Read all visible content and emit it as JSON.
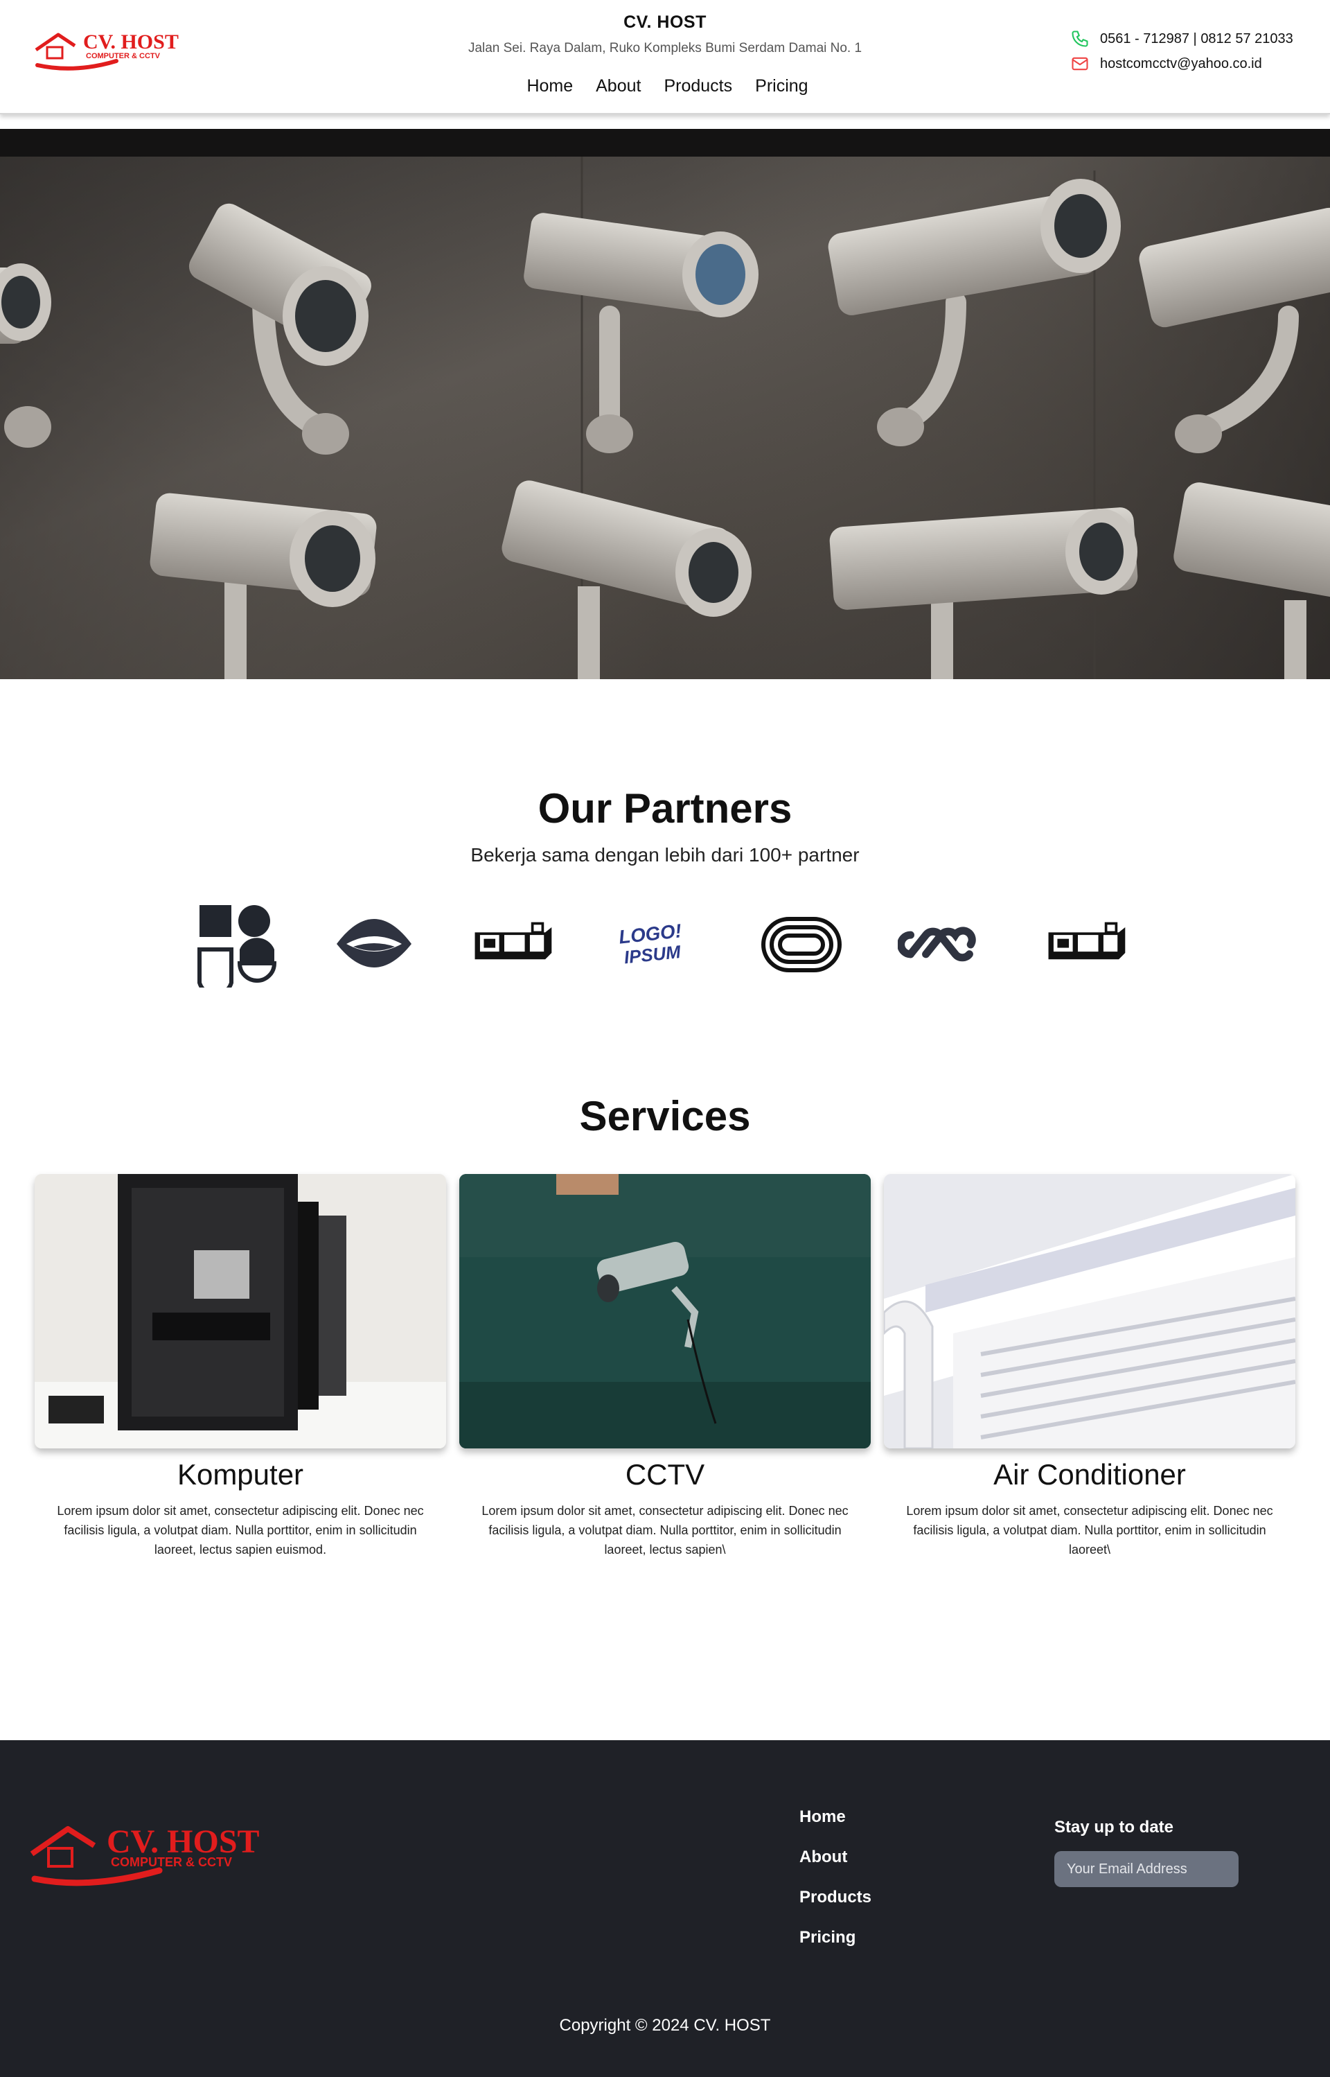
{
  "header": {
    "brand": {
      "title": "CV. HOST",
      "address": "Jalan Sei. Raya Dalam, Ruko Kompleks Bumi Serdam Damai No. 1",
      "logo_text": "CV. HOST",
      "logo_subtext": "COMPUTER & CCTV"
    },
    "nav": [
      "Home",
      "About",
      "Products",
      "Pricing"
    ],
    "contact": {
      "phone": "0561 - 712987 | 0812 57 21033",
      "email": "hostcomcctv@yahoo.co.id"
    },
    "icons": [
      "phone-icon",
      "mail-icon"
    ]
  },
  "hero": {
    "image": "row of wall-mounted Bosch CCTV cameras"
  },
  "partners": {
    "title": "Our Partners",
    "subtitle": "Bekerja sama dengan lebih dari 100+ partner",
    "logos": [
      "partner-logo-1",
      "partner-logo-2",
      "partner-logo-3",
      "partner-logo-4",
      "partner-logo-5",
      "partner-logo-6",
      "partner-logo-7"
    ],
    "logo_texts": [
      "LOGO!",
      "IPSUM"
    ]
  },
  "services": {
    "title": "Services",
    "items": [
      {
        "title": "Komputer",
        "text": "Lorem ipsum dolor sit amet, consectetur adipiscing elit. Donec nec facilisis ligula, a volutpat diam. Nulla porttitor, enim in sollicitudin laoreet, lectus sapien euismod."
      },
      {
        "title": "CCTV",
        "text": "Lorem ipsum dolor sit amet, consectetur adipiscing elit. Donec nec facilisis ligula, a volutpat diam. Nulla porttitor, enim in sollicitudin laoreet, lectus sapien\\"
      },
      {
        "title": "Air Conditioner",
        "text": "Lorem ipsum dolor sit amet, consectetur adipiscing elit. Donec nec facilisis ligula, a volutpat diam. Nulla porttitor, enim in sollicitudin laoreet\\"
      }
    ]
  },
  "footer": {
    "logo_text": "CV. HOST",
    "logo_subtext": "COMPUTER & CCTV",
    "nav": [
      "Home",
      "About",
      "Products",
      "Pricing"
    ],
    "subscribe_title": "Stay up to date",
    "email_placeholder": "Your Email Address",
    "copyright": "Copyright © 2024 CV. HOST"
  },
  "colors": {
    "accent": "#e11d1d",
    "footer_bg": "#1f2127",
    "input_bg": "#6b7280",
    "phone_icon": "#22c55e",
    "mail_icon": "#ef4444"
  }
}
